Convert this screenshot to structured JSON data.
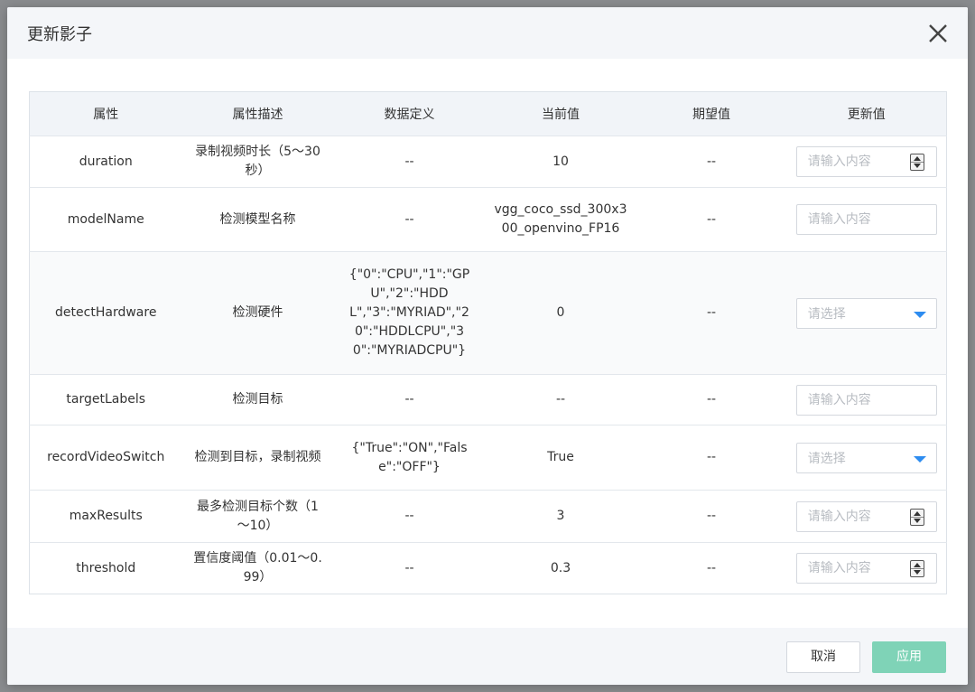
{
  "dialog": {
    "title": "更新影子",
    "close_icon": "close-icon",
    "cancel_label": "取消",
    "apply_label": "应用",
    "apply_color": "#7fd3b7",
    "header_bg": "#f4f6f9",
    "accent": "#2d8cf0"
  },
  "table": {
    "headers": [
      "属性",
      "属性描述",
      "数据定义",
      "当前值",
      "期望值",
      "更新值"
    ],
    "rows": [
      {
        "property": "duration",
        "description": "录制视频时长（5～30秒）",
        "definition": "--",
        "current": "10",
        "expected": "--",
        "control": "number",
        "placeholder": "请输入内容",
        "value": ""
      },
      {
        "property": "modelName",
        "description": "检测模型名称",
        "definition": "--",
        "current": "vgg_coco_ssd_300x300_openvino_FP16",
        "expected": "--",
        "control": "text",
        "placeholder": "请输入内容",
        "value": ""
      },
      {
        "property": "detectHardware",
        "description": "检测硬件",
        "definition": "{\"0\":\"CPU\",\"1\":\"GPU\",\"2\":\"HDDL\",\"3\":\"MYRIAD\",\"20\":\"HDDLCPU\",\"30\":\"MYRIADCPU\"}",
        "current": "0",
        "expected": "--",
        "control": "select",
        "placeholder": "请选择",
        "value": ""
      },
      {
        "property": "targetLabels",
        "description": "检测目标",
        "definition": "--",
        "current": "--",
        "expected": "--",
        "control": "text",
        "placeholder": "请输入内容",
        "value": ""
      },
      {
        "property": "recordVideoSwitch",
        "description": "检测到目标，录制视频",
        "definition": "{\"True\":\"ON\",\"False\":\"OFF\"}",
        "current": "True",
        "expected": "--",
        "control": "select",
        "placeholder": "请选择",
        "value": ""
      },
      {
        "property": "maxResults",
        "description": "最多检测目标个数（1～10）",
        "definition": "--",
        "current": "3",
        "expected": "--",
        "control": "number",
        "placeholder": "请输入内容",
        "value": ""
      },
      {
        "property": "threshold",
        "description": "置信度阈值（0.01～0.99）",
        "definition": "--",
        "current": "0.3",
        "expected": "--",
        "control": "number",
        "placeholder": "请输入内容",
        "value": ""
      }
    ]
  }
}
